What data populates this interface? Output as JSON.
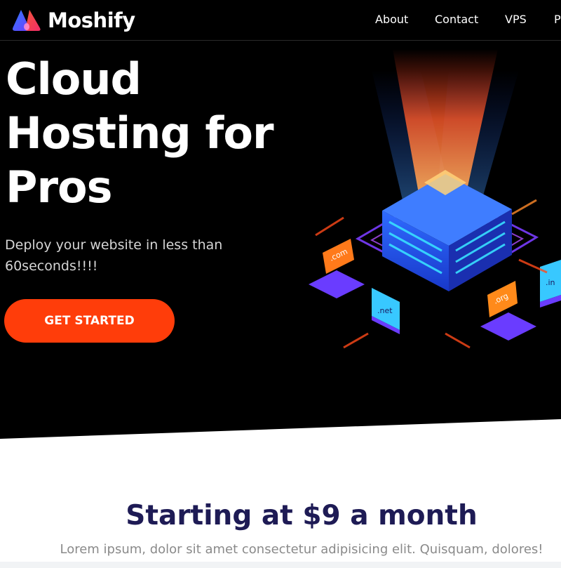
{
  "brand": {
    "name": "Moshify",
    "logo_icon": "triangle-logo-icon"
  },
  "nav": {
    "items": [
      "About",
      "Contact",
      "VPS",
      "P"
    ]
  },
  "hero": {
    "title": [
      "Cloud",
      "Hosting for",
      "Pros"
    ],
    "subtitle": "Deploy your website in less than 60seconds!!!!",
    "cta_label": "GET STARTED",
    "illustration_labels": [
      ".com",
      ".net",
      ".org",
      ".in"
    ]
  },
  "pricing": {
    "title": "Starting at $9 a month",
    "subtitle": "Lorem ipsum, dolor sit amet consectetur adipisicing elit. Quisquam, dolores!"
  },
  "colors": {
    "hero_bg": "#000000",
    "accent": "#ff3d0a",
    "heading_dark": "#1e1b55",
    "muted_text": "#8a8a8a"
  }
}
